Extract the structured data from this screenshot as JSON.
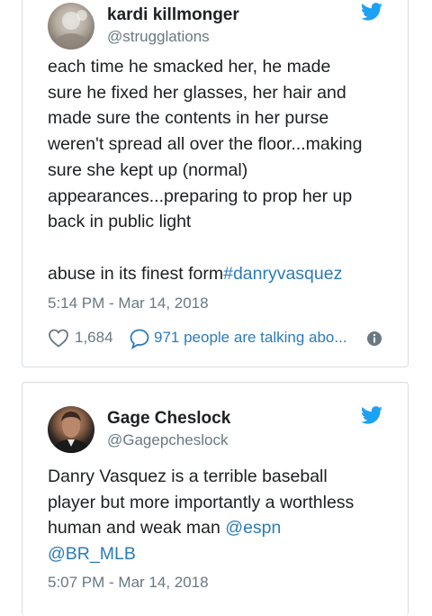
{
  "tweets": [
    {
      "display_name": "kardi killmonger",
      "handle": "@strugglations",
      "text_before": "each time he smacked her, he made\nsure he fixed her glasses, her hair and\nmade sure the contents in her purse\nweren't spread all over the floor...making\nsure she kept up (normal)\nappearances...preparing to prop her up\nback in public light\n\nabuse in its finest form",
      "hashtag": "#danryvasquez",
      "timestamp": "5:14 PM - Mar 14, 2018",
      "likes": "1,684",
      "talking": "971 people are talking abo..."
    },
    {
      "display_name": "Gage Cheslock",
      "handle": "@Gagepcheslock",
      "text_before": "Danry Vasquez is a terrible baseball\nplayer but more importantly a worthless\nhuman and weak man ",
      "mention1": "@espn",
      "mention2": "@BR_MLB",
      "timestamp": "5:07 PM - Mar 14, 2018"
    }
  ],
  "icons": {
    "brand": "twitter-bird-icon",
    "like": "heart-icon",
    "reply": "speech-bubble-icon",
    "info": "info-icon"
  },
  "colors": {
    "link": "#2b7bb9",
    "muted": "#697882",
    "twitter_blue": "#1da1f2"
  }
}
